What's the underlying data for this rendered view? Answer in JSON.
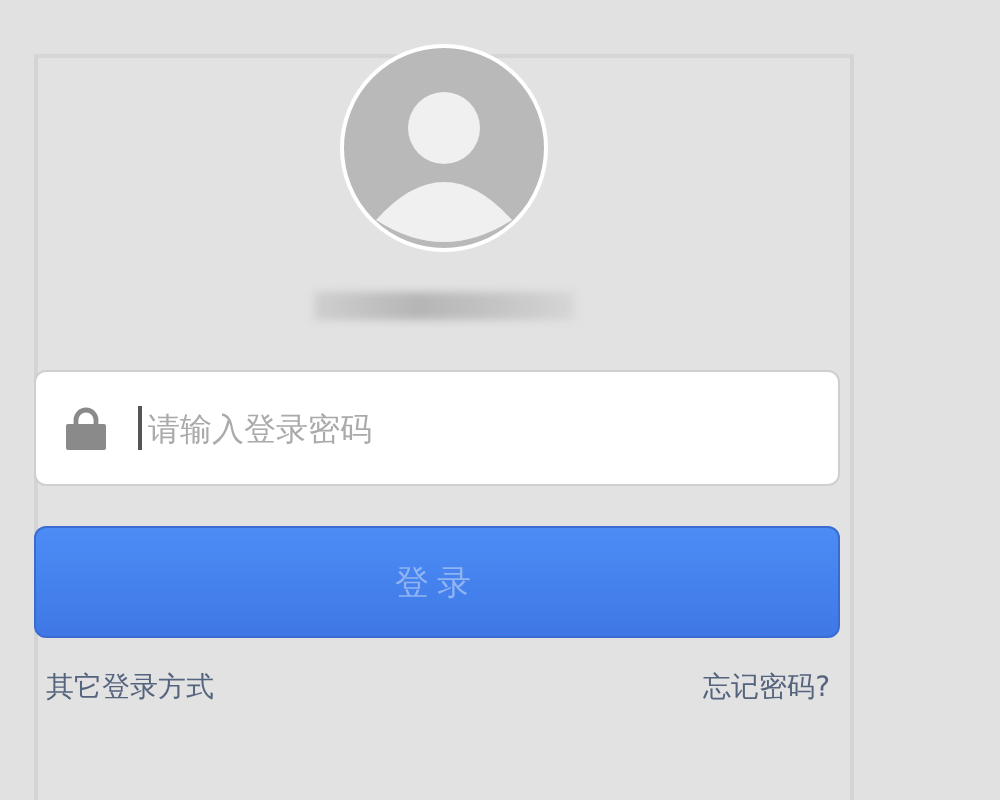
{
  "password_field": {
    "placeholder": "请输入登录密码"
  },
  "login_button": {
    "label": "登录",
    "disabled": true
  },
  "links": [
    {
      "label": "其它登录方式"
    },
    {
      "label": "忘记密码?"
    }
  ]
}
